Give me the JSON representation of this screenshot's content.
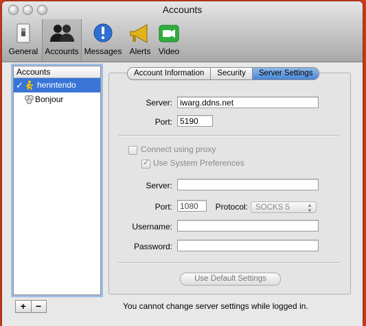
{
  "window": {
    "title": "Accounts"
  },
  "toolbar": {
    "items": [
      {
        "label": "General",
        "icon": "general-switch-icon",
        "selected": false
      },
      {
        "label": "Accounts",
        "icon": "accounts-people-icon",
        "selected": true
      },
      {
        "label": "Messages",
        "icon": "messages-exclamation-icon",
        "selected": false
      },
      {
        "label": "Alerts",
        "icon": "alerts-megaphone-icon",
        "selected": false
      },
      {
        "label": "Video",
        "icon": "video-camera-icon",
        "selected": false
      }
    ]
  },
  "accounts": {
    "header": "Accounts",
    "items": [
      {
        "name": "henntendo",
        "checked": true,
        "icon": "aim-runner-icon",
        "selected": true
      },
      {
        "name": "Bonjour",
        "checked": false,
        "icon": "bonjour-icon",
        "selected": false
      }
    ],
    "add_label": "+",
    "remove_label": "−"
  },
  "tabs": [
    {
      "label": "Account Information",
      "selected": false
    },
    {
      "label": "Security",
      "selected": false
    },
    {
      "label": "Server Settings",
      "selected": true
    }
  ],
  "server_settings": {
    "server_label": "Server:",
    "server_value": "iwarg.ddns.net",
    "port_label": "Port:",
    "port_value": "5190"
  },
  "proxy": {
    "connect_label": "Connect using proxy",
    "connect_checked": false,
    "system_prefs_label": "Use System Preferences",
    "system_prefs_checked": true,
    "server_label": "Server:",
    "server_value": "",
    "port_label": "Port:",
    "port_value": "1080",
    "protocol_label": "Protocol:",
    "protocol_value": "SOCKS 5",
    "username_label": "Username:",
    "username_value": "",
    "password_label": "Password:",
    "password_value": ""
  },
  "default_button_label": "Use Default Settings",
  "status_message": "You cannot change server settings while logged in.",
  "colors": {
    "selection": "#3875d7",
    "tab_selected": "#4a86d6",
    "desktop": "#d2401e"
  }
}
